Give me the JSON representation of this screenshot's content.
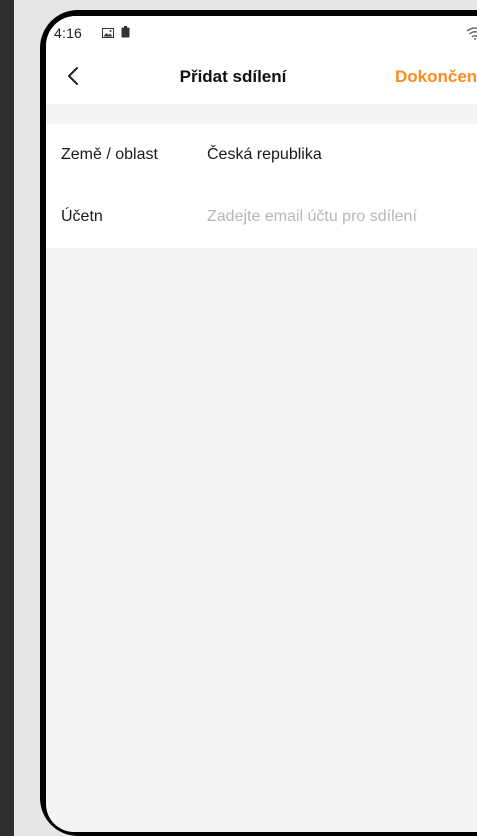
{
  "status_bar": {
    "time": "4:16",
    "icons": [
      "image-icon",
      "battery-icon",
      "wifi-icon"
    ]
  },
  "header": {
    "back_icon": "chevron-left-icon",
    "title": "Přidat sdílení",
    "done_label": "Dokončeno"
  },
  "form": {
    "region": {
      "label": "Země / oblast",
      "value": "Česká republika"
    },
    "account": {
      "label": "Účetn",
      "value": "",
      "placeholder": "Zadejte email účtu pro sdílení"
    }
  },
  "colors": {
    "accent": "#ff8c21",
    "background": "#f4f4f4",
    "surface": "#ffffff",
    "placeholder": "#b7b7b7"
  }
}
